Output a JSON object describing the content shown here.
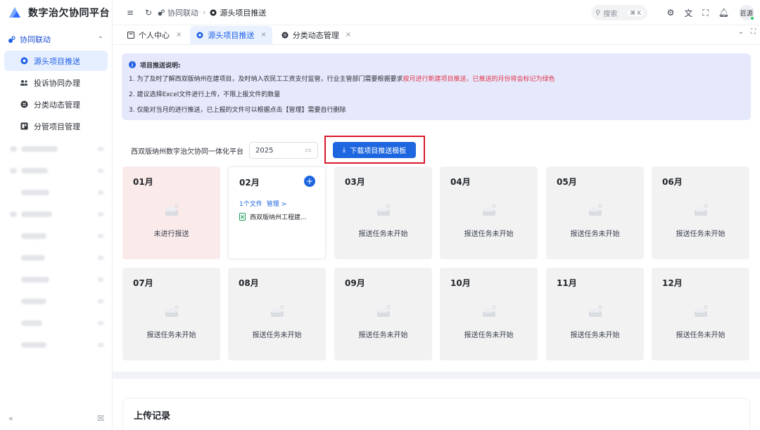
{
  "app": {
    "title": "数字治欠协同平台"
  },
  "sidebar": {
    "group": {
      "label": "协同联动"
    },
    "items": [
      {
        "label": "源头项目推送",
        "active": true,
        "icon": "dot-icon"
      },
      {
        "label": "投诉协同办理",
        "active": false,
        "icon": "users-icon"
      },
      {
        "label": "分类动态管理",
        "active": false,
        "icon": "fen-icon"
      },
      {
        "label": "分管项目管理",
        "active": false,
        "icon": "board-icon"
      }
    ],
    "footer": {
      "collapse": "«",
      "settings": "☒"
    }
  },
  "topbar": {
    "breadcrumb": [
      "协同联动",
      "源头项目推送"
    ],
    "search": {
      "placeholder": "搜索",
      "shortcut": "⌘ K"
    },
    "user": {
      "name": "匠源"
    }
  },
  "tabs": [
    {
      "label": "个人中心",
      "active": false
    },
    {
      "label": "源头项目推送",
      "active": true
    },
    {
      "label": "分类动态管理",
      "active": false
    }
  ],
  "notice": {
    "title": "项目推送说明:",
    "line1_pre": "1. 为了及时了解西双版纳州在建项目，及时纳入农民工工资支付监管，行业主管部门需要根据要求",
    "line1_red": "按月进行新建项目推送，已推送的月份将会标记为绿色",
    "line2": "2. 建议选择Excel文件进行上传，不限上报文件的数量",
    "line3": "3. 仅能对当月的进行推送，已上报的文件可以根据点击【管理】需要自行删除"
  },
  "filter": {
    "label": "西双版纳州数字治欠协同一体化平台",
    "year": "2025",
    "download_label": "下载项目推送模板"
  },
  "months": [
    {
      "name": "01月",
      "status": "未进行报送",
      "state": "pink"
    },
    {
      "name": "02月",
      "status": "",
      "state": "white",
      "file_count": "1个文件",
      "manage": "管理 >",
      "file_name": "西双版纳州工程建..."
    },
    {
      "name": "03月",
      "status": "报送任务未开始",
      "state": "grey"
    },
    {
      "name": "04月",
      "status": "报送任务未开始",
      "state": "grey"
    },
    {
      "name": "05月",
      "status": "报送任务未开始",
      "state": "grey"
    },
    {
      "name": "06月",
      "status": "报送任务未开始",
      "state": "grey"
    },
    {
      "name": "07月",
      "status": "报送任务未开始",
      "state": "grey"
    },
    {
      "name": "08月",
      "status": "报送任务未开始",
      "state": "grey"
    },
    {
      "name": "09月",
      "status": "报送任务未开始",
      "state": "grey"
    },
    {
      "name": "10月",
      "status": "报送任务未开始",
      "state": "grey"
    },
    {
      "name": "11月",
      "status": "报送任务未开始",
      "state": "grey"
    },
    {
      "name": "12月",
      "status": "报送任务未开始",
      "state": "grey"
    }
  ],
  "upload": {
    "title": "上传记录"
  },
  "colors": {
    "accent": "#1d66e0",
    "highlight_frame": "#d7192a",
    "notice_bg": "#e6e8fb",
    "warn_text": "#e2364a"
  }
}
